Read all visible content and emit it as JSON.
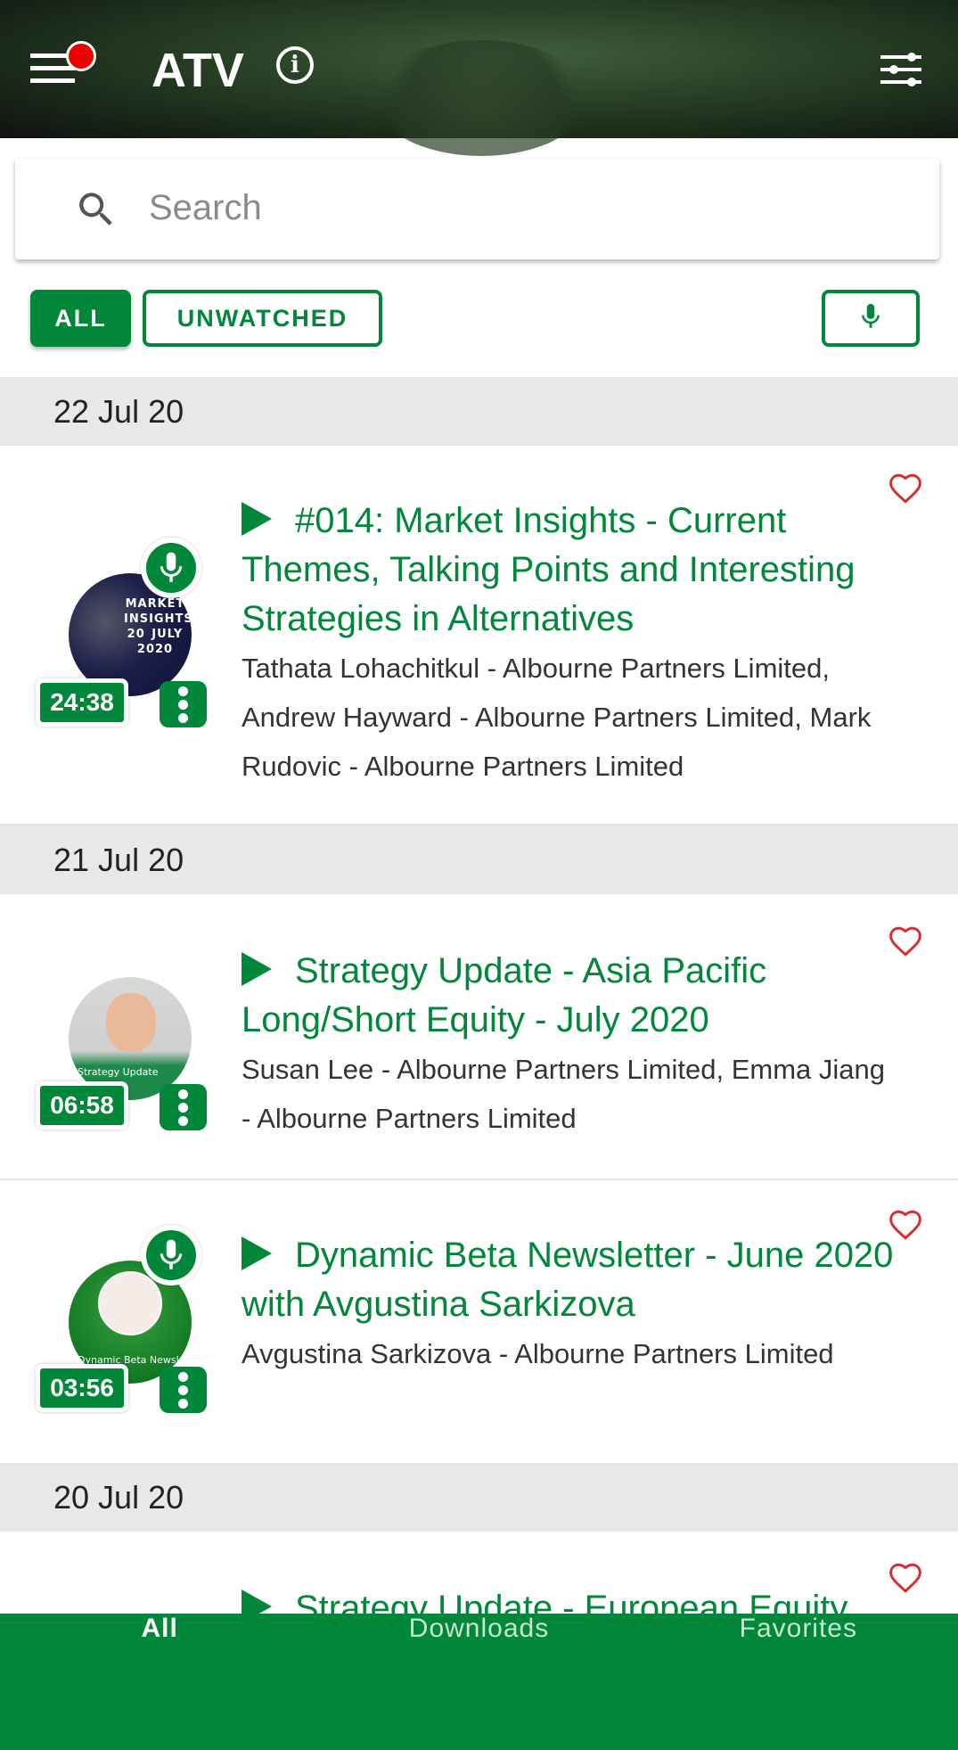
{
  "header": {
    "title": "ATV",
    "has_notification": true,
    "icons": [
      "menu-icon",
      "info-icon",
      "tune-icon"
    ]
  },
  "search": {
    "placeholder": "Search",
    "value": ""
  },
  "filters": {
    "all": "ALL",
    "unwatched": "UNWATCHED",
    "active": "ALL",
    "audio_filter_icon": "mic-icon"
  },
  "colors": {
    "brand": "#00873a",
    "notification": "#e00000",
    "heart": "#d32f2f"
  },
  "sections": [
    {
      "date": "22 Jul 20",
      "items": [
        {
          "title": "#014: Market Insights - Current Themes, Talking Points and Interesting Strategies in Alternatives",
          "speakers": "Tathata Lohachitkul - Albourne Partners Limited, Andrew Hayward - Albourne Partners Limited, Mark Rudovic - Albourne Partners Limited",
          "duration": "24:38",
          "audio": true,
          "thumb_text": "MARKET INSIGHTS 20 JULY 2020"
        }
      ]
    },
    {
      "date": "21 Jul 20",
      "items": [
        {
          "title": "Strategy Update - Asia Pacific Long/Short Equity - July 2020",
          "speakers": "Susan Lee - Albourne Partners Limited, Emma Jiang - Albourne Partners Limited",
          "duration": "06:58",
          "audio": false,
          "thumb_text": "Strategy Update"
        },
        {
          "title": "Dynamic Beta Newsletter - June 2020 with Avgustina Sarkizova",
          "speakers": "Avgustina Sarkizova - Albourne Partners Limited",
          "duration": "03:56",
          "audio": true,
          "thumb_text": "Dynamic Beta Newsletter"
        }
      ]
    },
    {
      "date": "20 Jul 20",
      "items": [
        {
          "title": "Strategy Update - European Equity"
        }
      ]
    }
  ],
  "bottom_nav": [
    {
      "label": "All",
      "active": true
    },
    {
      "label": "Downloads"
    },
    {
      "label": "Favorites"
    }
  ]
}
